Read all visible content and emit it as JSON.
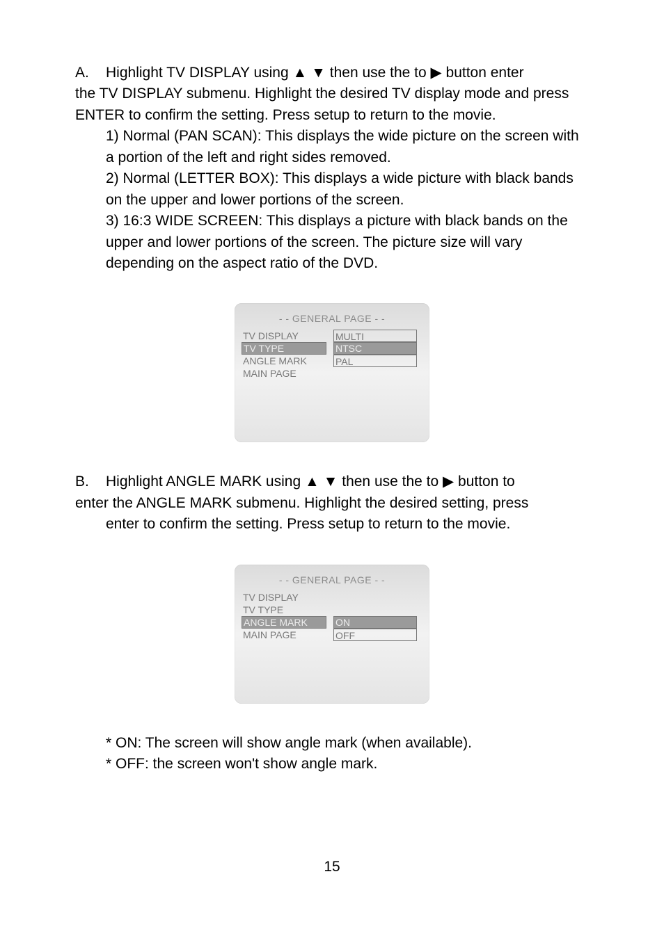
{
  "sectionA": {
    "label": "A.",
    "p1_a": "Highlight TV DISPLAY using ",
    "p1_b": " then use the to ",
    "p1_c": " button enter",
    "p2": "the TV  DISPLAY submenu. Highlight the desired TV display mode and press ENTER  to confirm the setting. Press setup to return to the movie.",
    "items": [
      "1)  Normal (PAN SCAN):  This displays the wide picture on the screen with a portion of the left and right sides removed.",
      "2)  Normal (LETTER BOX):  This displays a wide picture with black bands on the upper and lower portions of the screen.",
      "3)  16:3 WIDE SCREEN:  This displays a picture with black bands on the upper and lower portions of the screen.  The picture size will vary depending on the aspect ratio of the DVD."
    ]
  },
  "panel1": {
    "title": "- -  GENERAL PAGE  - -",
    "left": [
      "TV DISPLAY",
      "TV TYPE",
      "ANGLE MARK",
      "MAIN PAGE"
    ],
    "right": [
      "MULTI",
      "NTSC",
      "PAL"
    ]
  },
  "sectionB": {
    "label": "B.",
    "p1_a": "Highlight ANGLE MARK using ",
    "p1_b": " then use the to  ",
    "p1_c": " button to",
    "p2": "enter the ANGLE MARK submenu.  Highlight the desired setting, press",
    "p3": "enter  to confirm the setting.  Press setup to return to the movie."
  },
  "panel2": {
    "title": "- -  GENERAL PAGE  - -",
    "left": [
      "TV DISPLAY",
      "TV TYPE",
      "ANGLE MARK",
      "MAIN PAGE"
    ],
    "right": [
      "ON",
      "OFF"
    ]
  },
  "notes": [
    "*  ON: The screen will show angle mark (when available).",
    "*  OFF: the screen won't show angle mark."
  ],
  "pageNumber": "15"
}
